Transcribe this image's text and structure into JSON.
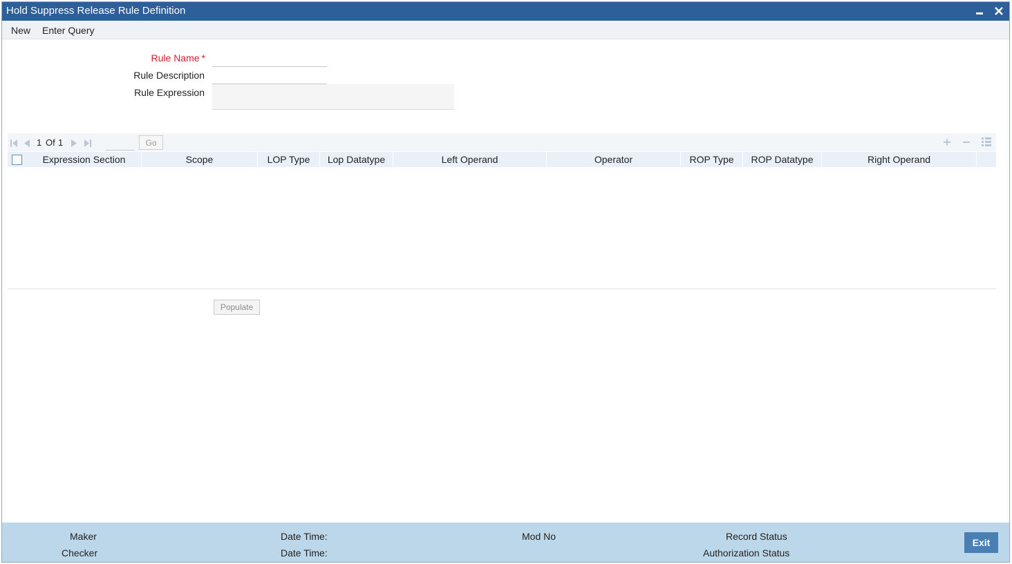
{
  "window": {
    "title": "Hold Suppress Release Rule Definition"
  },
  "menu": {
    "new_label": "New",
    "enter_query_label": "Enter Query"
  },
  "form": {
    "rule_name_label": "Rule Name",
    "required_marker": "*",
    "rule_description_label": "Rule Description",
    "rule_expression_label": "Rule Expression",
    "rule_name_value": "",
    "rule_description_value": "",
    "rule_expression_value": ""
  },
  "grid": {
    "pagination": {
      "current": "1",
      "of_label": "Of",
      "total": "1",
      "page_input": "",
      "go_label": "Go"
    },
    "columns": [
      "Expression Section",
      "Scope",
      "LOP Type",
      "Lop Datatype",
      "Left Operand",
      "Operator",
      "ROP Type",
      "ROP Datatype",
      "Right Operand"
    ],
    "rows": []
  },
  "actions": {
    "populate_label": "Populate",
    "exit_label": "Exit"
  },
  "footer": {
    "maker_label": "Maker",
    "checker_label": "Checker",
    "date_time_label_1": "Date Time:",
    "date_time_label_2": "Date Time:",
    "mod_no_label": "Mod No",
    "record_status_label": "Record Status",
    "authorization_status_label": "Authorization Status"
  },
  "icons": {
    "minimize": "minimize-icon",
    "close": "close-icon",
    "first_page": "first-page-icon",
    "prev_page": "prev-page-icon",
    "next_page": "next-page-icon",
    "last_page": "last-page-icon",
    "add_row": "add-row-icon",
    "delete_row": "delete-row-icon",
    "single_view": "single-view-icon"
  },
  "colors": {
    "titlebar": "#2d5f9a",
    "required": "#d0202a",
    "footer": "#bdd7ea",
    "exit_button": "#4a7fb3",
    "grid_header": "#eaf0f7"
  }
}
